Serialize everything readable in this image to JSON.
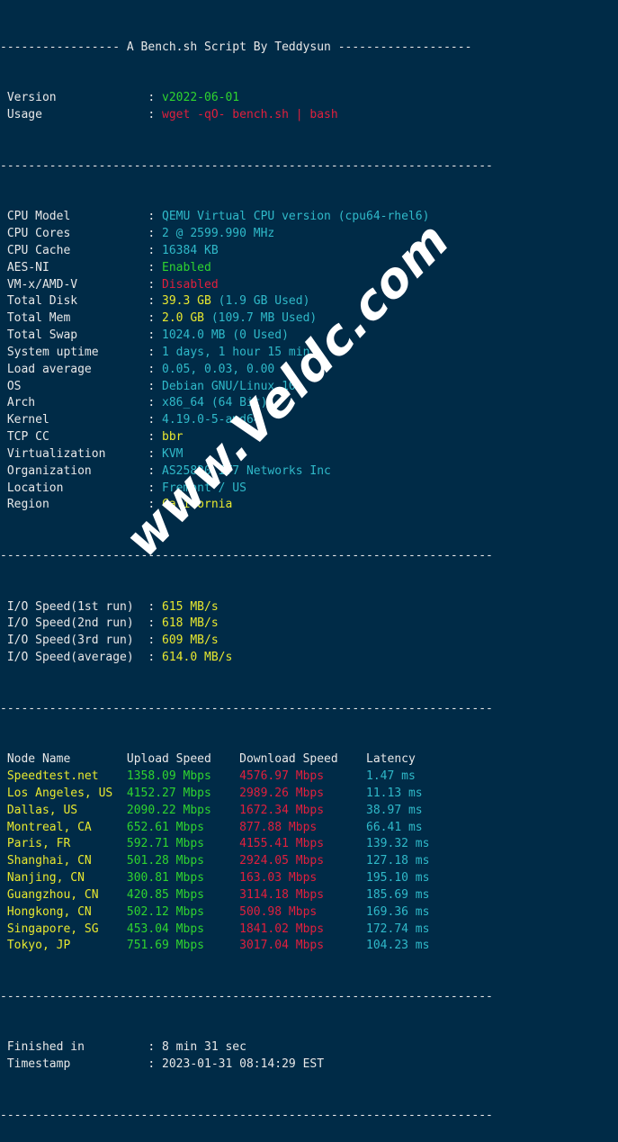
{
  "header": {
    "dashes_left": "-----------------",
    "title": "A Bench.sh Script By Teddysun",
    "dashes_right": "-------------------"
  },
  "divider": "----------------------------------------------------------------------",
  "info_top": [
    {
      "label": " Version",
      "colon": ":",
      "value": "v2022-06-01",
      "color": "green"
    },
    {
      "label": " Usage",
      "colon": ":",
      "value": "wget -qO- bench.sh | bash",
      "color": "red"
    }
  ],
  "system": [
    {
      "label": " CPU Model",
      "colon": ":",
      "value": "QEMU Virtual CPU version (cpu64-rhel6)",
      "color": "cyan"
    },
    {
      "label": " CPU Cores",
      "colon": ":",
      "value": "2 @ 2599.990 MHz",
      "color": "cyan"
    },
    {
      "label": " CPU Cache",
      "colon": ":",
      "value": "16384 KB",
      "color": "cyan"
    },
    {
      "label": " AES-NI",
      "colon": ":",
      "value": "Enabled",
      "color": "green"
    },
    {
      "label": " VM-x/AMD-V",
      "colon": ":",
      "value": "Disabled",
      "color": "red"
    },
    {
      "label": " Total Disk",
      "colon": ":",
      "value": "39.3 GB",
      "color": "yellow",
      "extra": " (1.9 GB Used)",
      "extra_color": "cyan"
    },
    {
      "label": " Total Mem",
      "colon": ":",
      "value": "2.0 GB",
      "color": "yellow",
      "extra": " (109.7 MB Used)",
      "extra_color": "cyan"
    },
    {
      "label": " Total Swap",
      "colon": ":",
      "value": "1024.0 MB (0 Used)",
      "color": "cyan"
    },
    {
      "label": " System uptime",
      "colon": ":",
      "value": "1 days, 1 hour 15 min",
      "color": "cyan"
    },
    {
      "label": " Load average",
      "colon": ":",
      "value": "0.05, 0.03, 0.00",
      "color": "cyan"
    },
    {
      "label": " OS",
      "colon": ":",
      "value": "Debian GNU/Linux 10",
      "color": "cyan"
    },
    {
      "label": " Arch",
      "colon": ":",
      "value": "x86_64 (64 Bit)",
      "color": "cyan"
    },
    {
      "label": " Kernel",
      "colon": ":",
      "value": "4.19.0-5-amd64",
      "color": "cyan"
    },
    {
      "label": " TCP CC",
      "colon": ":",
      "value": "bbr",
      "color": "yellow"
    },
    {
      "label": " Virtualization",
      "colon": ":",
      "value": "KVM",
      "color": "cyan"
    },
    {
      "label": " Organization",
      "colon": ":",
      "value": "AS25820 IT7 Networks Inc",
      "color": "cyan"
    },
    {
      "label": " Location",
      "colon": ":",
      "value": "Fremont / US",
      "color": "cyan"
    },
    {
      "label": " Region",
      "colon": ":",
      "value": "California",
      "color": "yellow"
    }
  ],
  "io_speed": [
    {
      "label": " I/O Speed(1st run)",
      "colon": ":",
      "value": "615 MB/s",
      "color": "yellow"
    },
    {
      "label": " I/O Speed(2nd run)",
      "colon": ":",
      "value": "618 MB/s",
      "color": "yellow"
    },
    {
      "label": " I/O Speed(3rd run)",
      "colon": ":",
      "value": "609 MB/s",
      "color": "yellow"
    },
    {
      "label": " I/O Speed(average)",
      "colon": ":",
      "value": "614.0 MB/s",
      "color": "yellow"
    }
  ],
  "speedtest": {
    "columns": [
      "Node Name",
      "Upload Speed",
      "Download Speed",
      "Latency"
    ],
    "rows": [
      {
        "node": "Speedtest.net",
        "upload": "1358.09 Mbps",
        "download": "4576.97 Mbps",
        "latency": "1.47 ms"
      },
      {
        "node": "Los Angeles, US",
        "upload": "4152.27 Mbps",
        "download": "2989.26 Mbps",
        "latency": "11.13 ms"
      },
      {
        "node": "Dallas, US",
        "upload": "2090.22 Mbps",
        "download": "1672.34 Mbps",
        "latency": "38.97 ms"
      },
      {
        "node": "Montreal, CA",
        "upload": "652.61 Mbps",
        "download": "877.88 Mbps",
        "latency": "66.41 ms"
      },
      {
        "node": "Paris, FR",
        "upload": "592.71 Mbps",
        "download": "4155.41 Mbps",
        "latency": "139.32 ms"
      },
      {
        "node": "Shanghai, CN",
        "upload": "501.28 Mbps",
        "download": "2924.05 Mbps",
        "latency": "127.18 ms"
      },
      {
        "node": "Nanjing, CN",
        "upload": "300.81 Mbps",
        "download": "163.03 Mbps",
        "latency": "195.10 ms"
      },
      {
        "node": "Guangzhou, CN",
        "upload": "420.85 Mbps",
        "download": "3114.18 Mbps",
        "latency": "185.69 ms"
      },
      {
        "node": "Hongkong, CN",
        "upload": "502.12 Mbps",
        "download": "500.98 Mbps",
        "latency": "169.36 ms"
      },
      {
        "node": "Singapore, SG",
        "upload": "453.04 Mbps",
        "download": "1841.02 Mbps",
        "latency": "172.74 ms"
      },
      {
        "node": "Tokyo, JP",
        "upload": "751.69 Mbps",
        "download": "3017.04 Mbps",
        "latency": "104.23 ms"
      }
    ]
  },
  "footer": [
    {
      "label": " Finished in",
      "colon": ":",
      "value": "8 min 31 sec",
      "color": "white"
    },
    {
      "label": " Timestamp",
      "colon": ":",
      "value": "2023-01-31 08:14:29 EST",
      "color": "white"
    }
  ],
  "watermark": {
    "text": "www.Veldc.com"
  },
  "colors": {
    "background": "#002b47",
    "foreground": "#e8e8e8",
    "green": "#2fd42f",
    "red": "#e21f3d",
    "cyan": "#2fb9c9",
    "yellow": "#e8e82f"
  }
}
